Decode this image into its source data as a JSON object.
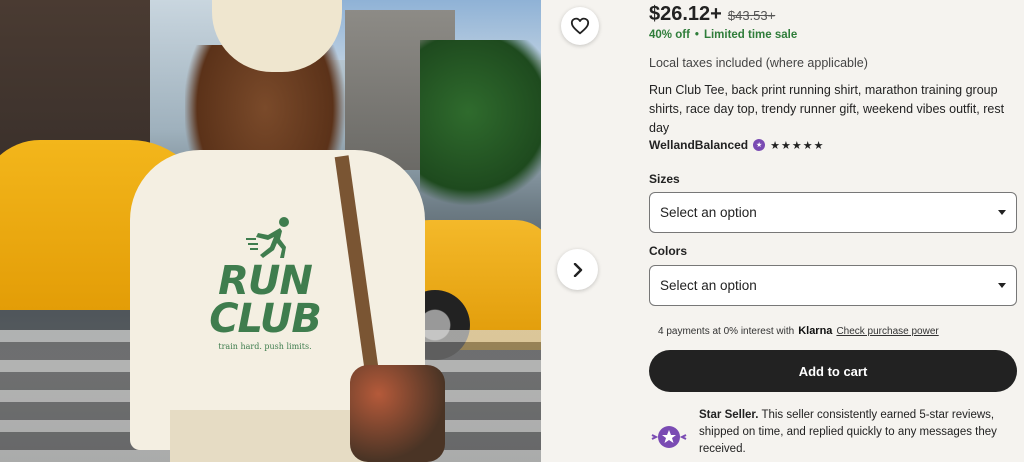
{
  "listing": {
    "price": "$26.12+",
    "original_price": "$43.53+",
    "discount": "40% off",
    "sale_separator": "•",
    "sale_text": "Limited time sale",
    "taxes_note": "Local taxes included (where applicable)",
    "title": "Run Club Tee, back print running shirt, marathon training group shirts, race day top, trendy runner gift, weekend vibes outfit, rest day",
    "shop_name": "WellandBalanced",
    "rating_stars": "★★★★★",
    "rating": 5
  },
  "image": {
    "print_title": "RUN CLUB",
    "print_tagline": "train hard.  push limits.",
    "favorite_icon": "heart-outline-icon",
    "next_icon": "chevron-right-icon"
  },
  "options": {
    "sizes_label": "Sizes",
    "sizes_value": "Select an option",
    "colors_label": "Colors",
    "colors_value": "Select an option"
  },
  "payment": {
    "klarna_prefix": "4 payments at 0% interest with",
    "klarna_brand": "Klarna",
    "klarna_link": "Check purchase power"
  },
  "cart": {
    "add_label": "Add to cart"
  },
  "star_seller": {
    "title": "Star Seller.",
    "body": " This seller consistently earned 5-star reviews, shipped on time, and replied quickly to any messages they received."
  },
  "colors": {
    "sale_green": "#2f7d3a",
    "print_green": "#3f7d4e",
    "button_dark": "#222222",
    "badge_purple": "#7a4bb3"
  }
}
